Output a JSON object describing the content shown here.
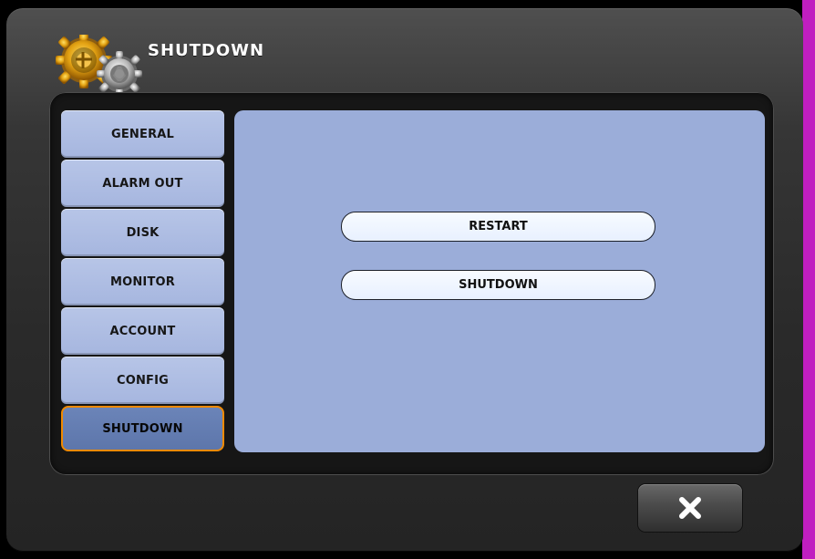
{
  "window": {
    "title": "SHUTDOWN",
    "icon": "gear-icon"
  },
  "sidebar": {
    "items": [
      {
        "label": "GENERAL"
      },
      {
        "label": "ALARM OUT"
      },
      {
        "label": "DISK"
      },
      {
        "label": "MONITOR"
      },
      {
        "label": "ACCOUNT"
      },
      {
        "label": "CONFIG"
      },
      {
        "label": "SHUTDOWN",
        "active": true
      }
    ]
  },
  "main": {
    "buttons": [
      {
        "label": "RESTART"
      },
      {
        "label": "SHUTDOWN"
      }
    ]
  },
  "footer": {
    "close_icon": "close-icon"
  },
  "colors": {
    "panel": "#9badd9",
    "tab": "#b7c5e7",
    "active_tab": "#6b84b8",
    "active_border": "#f08a00",
    "magenta_edge": "#c01ec0"
  }
}
